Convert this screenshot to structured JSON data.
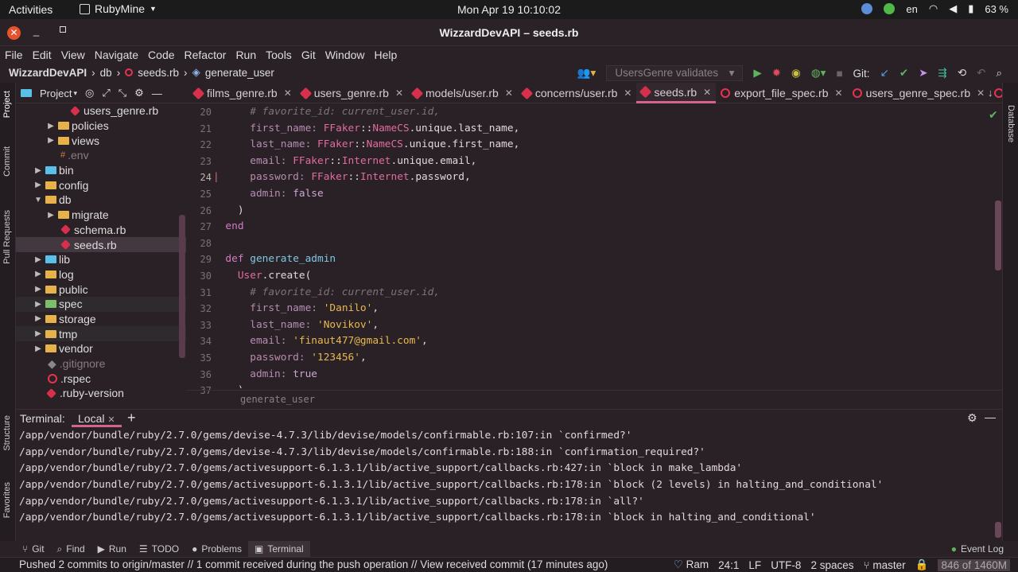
{
  "topbar": {
    "activities": "Activities",
    "app": "RubyMine",
    "clock": "Mon Apr 19  10:10:02",
    "lang": "en",
    "battery": "63 %"
  },
  "window": {
    "title": "WizzardDevAPI – seeds.rb"
  },
  "menu": [
    "File",
    "Edit",
    "View",
    "Navigate",
    "Code",
    "Refactor",
    "Run",
    "Tools",
    "Git",
    "Window",
    "Help"
  ],
  "nav": {
    "project": "WizzardDevAPI",
    "folder": "db",
    "file": "seeds.rb",
    "method": "generate_user",
    "run_config": "UsersGenre validates",
    "git_label": "Git:"
  },
  "project_header": "Project",
  "tabs": [
    {
      "label": "films_genre.rb"
    },
    {
      "label": "users_genre.rb"
    },
    {
      "label": "models/user.rb"
    },
    {
      "label": "concerns/user.rb"
    },
    {
      "label": "seeds.rb"
    },
    {
      "label": "export_file_spec.rb"
    },
    {
      "label": "users_genre_spec.rb"
    }
  ],
  "tree": [
    {
      "label": "users_genre.rb",
      "kind": "rb"
    },
    {
      "label": "policies",
      "kind": "folder"
    },
    {
      "label": "views",
      "kind": "folder"
    },
    {
      "label": ".env",
      "kind": "env"
    },
    {
      "label": "bin",
      "kind": "folder"
    },
    {
      "label": "config",
      "kind": "folder"
    },
    {
      "label": "db",
      "kind": "folder"
    },
    {
      "label": "migrate",
      "kind": "folder"
    },
    {
      "label": "schema.rb",
      "kind": "rb"
    },
    {
      "label": "seeds.rb",
      "kind": "rb"
    },
    {
      "label": "lib",
      "kind": "folder"
    },
    {
      "label": "log",
      "kind": "folder"
    },
    {
      "label": "public",
      "kind": "folder"
    },
    {
      "label": "spec",
      "kind": "folder"
    },
    {
      "label": "storage",
      "kind": "folder"
    },
    {
      "label": "tmp",
      "kind": "folder"
    },
    {
      "label": "vendor",
      "kind": "folder"
    },
    {
      "label": ".gitignore",
      "kind": "git"
    },
    {
      "label": ".rspec",
      "kind": "rspec"
    },
    {
      "label": ".ruby-version",
      "kind": "rb"
    }
  ],
  "line_numbers": [
    "20",
    "21",
    "22",
    "23",
    "24",
    "25",
    "26",
    "27",
    "28",
    "29",
    "30",
    "31",
    "32",
    "33",
    "34",
    "35",
    "36",
    "37"
  ],
  "code_breadcrumb": "generate_user",
  "terminal": {
    "title": "Terminal:",
    "tab": "Local",
    "lines": [
      "/app/vendor/bundle/ruby/2.7.0/gems/devise-4.7.3/lib/devise/models/confirmable.rb:107:in `confirmed?'",
      "/app/vendor/bundle/ruby/2.7.0/gems/devise-4.7.3/lib/devise/models/confirmable.rb:188:in `confirmation_required?'",
      "/app/vendor/bundle/ruby/2.7.0/gems/activesupport-6.1.3.1/lib/active_support/callbacks.rb:427:in `block in make_lambda'",
      "/app/vendor/bundle/ruby/2.7.0/gems/activesupport-6.1.3.1/lib/active_support/callbacks.rb:178:in `block (2 levels) in halting_and_conditional'",
      "/app/vendor/bundle/ruby/2.7.0/gems/activesupport-6.1.3.1/lib/active_support/callbacks.rb:178:in `all?'",
      "/app/vendor/bundle/ruby/2.7.0/gems/activesupport-6.1.3.1/lib/active_support/callbacks.rb:178:in `block in halting_and_conditional'"
    ]
  },
  "bottom_tools": [
    "Git",
    "Find",
    "Run",
    "TODO",
    "Problems",
    "Terminal"
  ],
  "event_log": "Event Log",
  "side_labels": {
    "project": "Project",
    "commit": "Commit",
    "pull": "Pull Requests",
    "structure": "Structure",
    "favorites": "Favorites",
    "database": "Database"
  },
  "status": {
    "message": "Pushed 2 commits to origin/master // 1 commit received during the push operation // View received commit (17 minutes ago)",
    "ram": "Ram",
    "pos": "24:1",
    "eol": "LF",
    "enc": "UTF-8",
    "indent": "2 spaces",
    "branch": "master",
    "memory": "846 of 1460M"
  },
  "code": {
    "c1": "# favorite_id: current_user.id,",
    "first_name": "first_name:",
    "last_name": "last_name:",
    "email": "email:",
    "password": "password:",
    "admin": "admin:",
    "ffaker": "FFaker",
    "namecs": "NameCS",
    "internet": "Internet",
    "sep": "::",
    "unique": ".unique",
    "lastn": ".last_name,",
    "firstn": ".first_name,",
    "emailm": ".email,",
    "pwdm": ".password,",
    "false": "false",
    "rparen": ")",
    "end": "end",
    "def": "def",
    "gen_admin": "generate_admin",
    "user": "User",
    "create": ".create(",
    "danilo": "'Danilo'",
    "novikov": "'Novikov'",
    "mail": "'finaut477@gmail.com'",
    "pw": "'123456'",
    "true": "true",
    "comma": ","
  }
}
